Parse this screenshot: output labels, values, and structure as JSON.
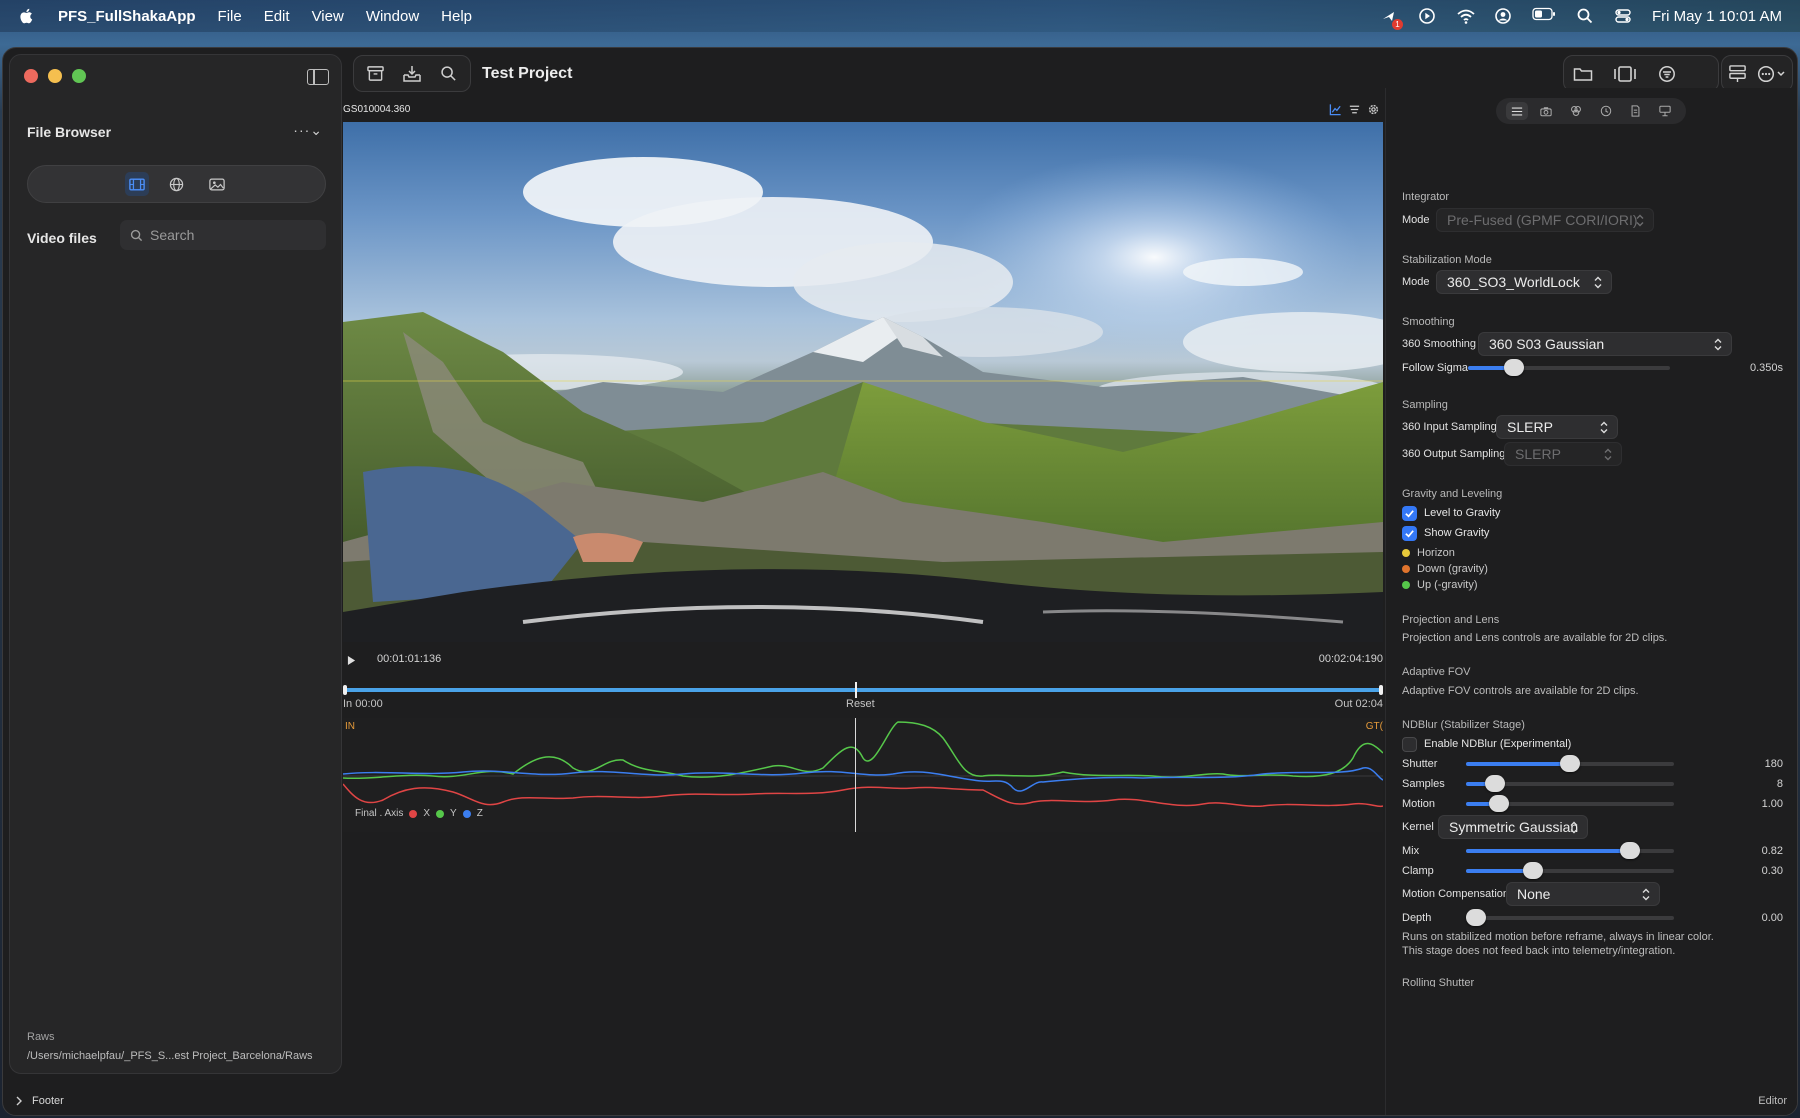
{
  "menubar": {
    "app_name": "PFS_FullShakaApp",
    "menus": [
      "File",
      "Edit",
      "View",
      "Window",
      "Help"
    ],
    "notification_count": "1",
    "clock": "Fri May 1  10:01 AM"
  },
  "sidebar": {
    "title": "File Browser",
    "menu_label": "···⌄",
    "video_files_label": "Video files",
    "search_placeholder": "Search",
    "raws_label": "Raws",
    "raws_path": "/Users/michaelpfau/_PFS_S...est Project_Barcelona/Raws"
  },
  "toolbar": {
    "project_title": "Test Project"
  },
  "video": {
    "clip_name": "GS010004.360",
    "current_time": "00:01:01:136",
    "total_time": "00:02:04:190",
    "playhead_fraction": 0.492,
    "in_label": "In 00:00",
    "reset_label": "Reset",
    "out_label": "Out 02:04",
    "graph_in_marker": "IN",
    "graph_out_marker": "GT(",
    "graph_legend": {
      "title": "Final . Axis",
      "x": "X",
      "y": "Y",
      "z": "Z"
    }
  },
  "inspector": {
    "integrator": {
      "title": "Integrator",
      "mode_label": "Mode",
      "mode_value": "Pre-Fused (GPMF CORI/IORI)"
    },
    "stabilization": {
      "title": "Stabilization Mode",
      "mode_label": "Mode",
      "mode_value": "360_SO3_WorldLock"
    },
    "smoothing": {
      "title": "Smoothing",
      "smoothing_label": "360 Smoothing",
      "smoothing_value": "360 S03 Gaussian",
      "sigma_label": "Follow Sigma",
      "sigma_value": "0.350s",
      "sigma_fraction": 0.23
    },
    "sampling": {
      "title": "Sampling",
      "input_label": "360 Input Sampling",
      "input_value": "SLERP",
      "output_label": "360 Output Sampling",
      "output_value": "SLERP"
    },
    "gravity": {
      "title": "Gravity and Leveling",
      "level_label": "Level to Gravity",
      "show_label": "Show Gravity",
      "legend": [
        {
          "label": "Horizon",
          "color": "#e8c93a"
        },
        {
          "label": "Down (gravity)",
          "color": "#e0742d"
        },
        {
          "label": "Up (-gravity)",
          "color": "#56c74a"
        }
      ]
    },
    "projection": {
      "title": "Projection and Lens",
      "note": "Projection and Lens controls are available for 2D clips."
    },
    "adaptive_fov": {
      "title": "Adaptive FOV",
      "note": "Adaptive FOV controls are available for 2D clips."
    },
    "ndblur": {
      "title": "NDBlur (Stabilizer Stage)",
      "enable_label": "Enable NDBlur (Experimental)",
      "shutter_label": "Shutter",
      "shutter_value": "180",
      "shutter_fraction": 0.5,
      "samples_label": "Samples",
      "samples_value": "8",
      "samples_fraction": 0.14,
      "motion_label": "Motion",
      "motion_value": "1.00",
      "motion_fraction": 0.16,
      "kernel_label": "Kernel",
      "kernel_value": "Symmetric Gaussian",
      "mix_label": "Mix",
      "mix_value": "0.82",
      "mix_fraction": 0.79,
      "clamp_label": "Clamp",
      "clamp_value": "0.30",
      "clamp_fraction": 0.32,
      "motion_comp_label": "Motion Compensation",
      "motion_comp_value": "None",
      "depth_label": "Depth",
      "depth_value": "0.00",
      "depth_fraction": 0.0,
      "note": "Runs on stabilized motion before reframe, always in linear color. This stage does not feed back into telemetry/integration."
    },
    "rolling_shutter": {
      "title": "Rolling Shutter"
    }
  },
  "footer": {
    "label": "Footer",
    "right_label": "Editor"
  },
  "colors": {
    "accent": "#3b7ef0",
    "axis_x": "#e04545",
    "axis_y": "#56c74a",
    "axis_z": "#3b7ef0"
  }
}
